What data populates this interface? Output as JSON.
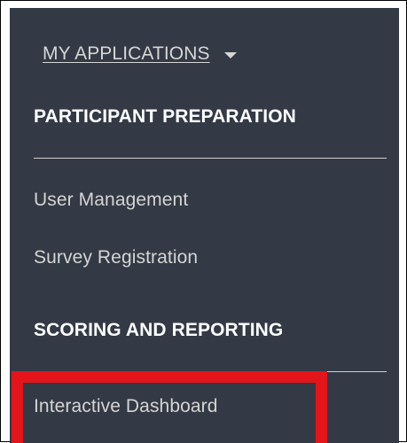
{
  "menu": {
    "dropdown_label": "MY APPLICATIONS",
    "dropdown_icon": "chevron-down-icon",
    "sections": [
      {
        "heading": "PARTICIPANT PREPARATION",
        "items": [
          {
            "label": "User Management"
          },
          {
            "label": "Survey Registration"
          }
        ]
      },
      {
        "heading": "SCORING AND REPORTING",
        "items": [
          {
            "label": "Interactive Dashboard",
            "highlighted": true
          }
        ]
      }
    ]
  },
  "colors": {
    "panel_background": "#333a45",
    "heading_text": "#ffffff",
    "link_text": "#d4d4d4",
    "highlight": "#e3151b"
  }
}
